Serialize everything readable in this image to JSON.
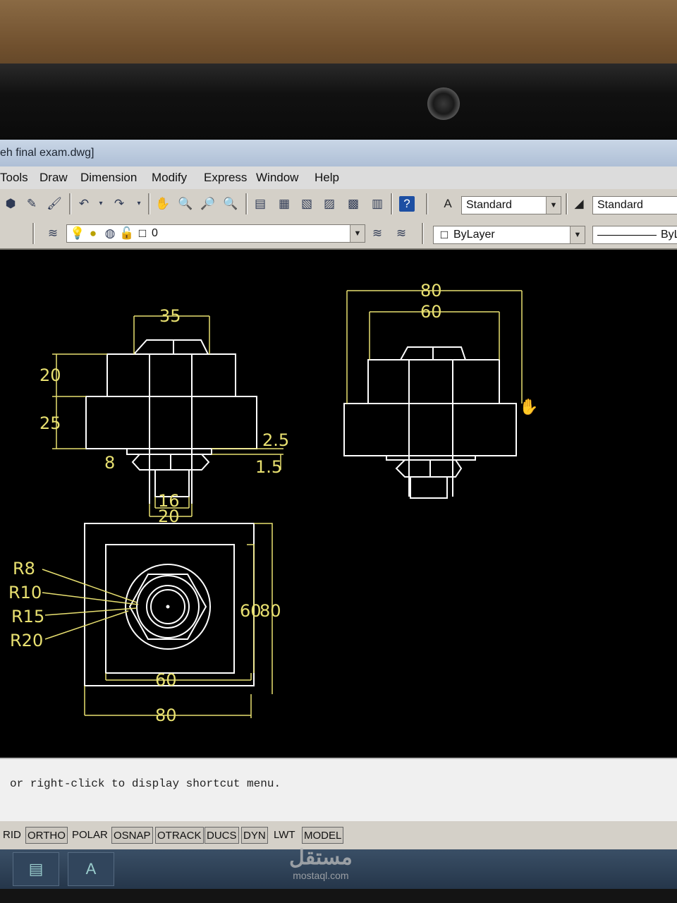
{
  "window": {
    "title": "eh final exam.dwg]"
  },
  "menu": [
    "Tools",
    "Draw",
    "Dimension",
    "Modify",
    "Express",
    "Window",
    "Help"
  ],
  "toolbar": {
    "text_style": "Standard",
    "dim_style": "Standard",
    "layer": "0",
    "color": "ByLayer",
    "linetype": "ByL"
  },
  "drawing": {
    "front": {
      "width_top": "35",
      "h1": "20",
      "h2": "25",
      "washer_a": "2.5",
      "washer_b": "1.5",
      "nut": "8",
      "shank_inner": "16",
      "shank_outer": "20"
    },
    "side": {
      "outer_width": "80",
      "inner_width": "60"
    },
    "top": {
      "radii": [
        "R8",
        "R10",
        "R15",
        "R20"
      ],
      "inner_side": "60",
      "outer_side": "80",
      "vert_inner": "60",
      "vert_outer": "80",
      "bottom_inner": "60",
      "bottom_outer": "80"
    }
  },
  "command": {
    "text": "or right-click to display shortcut menu."
  },
  "status": [
    "RID",
    "ORTHO",
    "POLAR",
    "OSNAP",
    "OTRACK",
    "DUCS",
    "DYN",
    "LWT",
    "MODEL"
  ],
  "watermark": {
    "logo": "مستقل",
    "url": "mostaql.com"
  }
}
